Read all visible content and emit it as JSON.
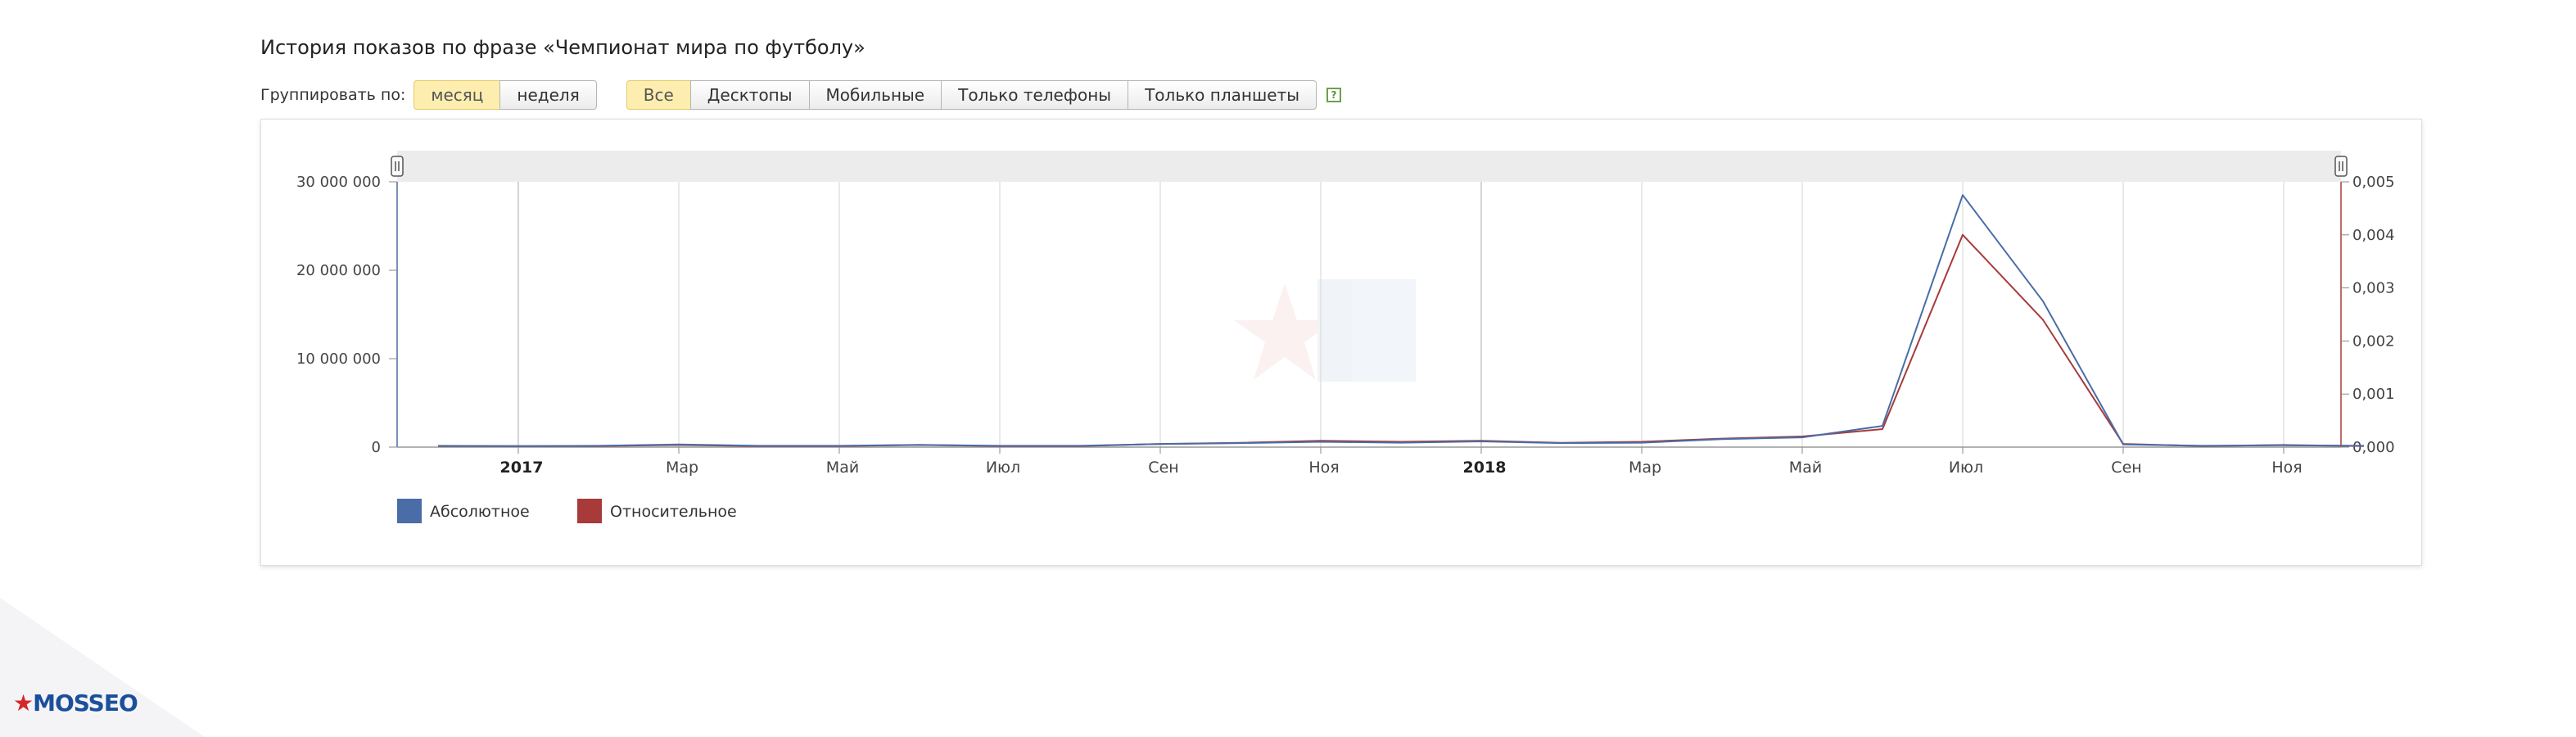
{
  "title": "История показов по фразе «Чемпионат мира по футболу»",
  "group_label": "Группировать по:",
  "group_buttons": [
    {
      "label": "месяц",
      "active": true
    },
    {
      "label": "неделя",
      "active": false
    }
  ],
  "device_buttons": [
    {
      "label": "Все",
      "active": true
    },
    {
      "label": "Десктопы",
      "active": false
    },
    {
      "label": "Мобильные",
      "active": false
    },
    {
      "label": "Только телефоны",
      "active": false
    },
    {
      "label": "Только планшеты",
      "active": false
    }
  ],
  "help_icon": "?",
  "watermark_logo": {
    "star": "★",
    "text": "MOSSEO",
    "text_color": "#1b4f9c",
    "star_color": "#d6262b"
  },
  "chart_data": {
    "type": "line",
    "title": "",
    "x_labels": [
      "2017",
      "Мар",
      "Май",
      "Июл",
      "Сен",
      "Ноя",
      "2018",
      "Мар",
      "Май",
      "Июл",
      "Сен",
      "Ноя"
    ],
    "year_labels": [
      "2017",
      "2018"
    ],
    "x": [
      "2016-12",
      "2017-01",
      "2017-02",
      "2017-03",
      "2017-04",
      "2017-05",
      "2017-06",
      "2017-07",
      "2017-08",
      "2017-09",
      "2017-10",
      "2017-11",
      "2017-12",
      "2018-01",
      "2018-02",
      "2018-03",
      "2018-04",
      "2018-05",
      "2018-06",
      "2018-07",
      "2018-08",
      "2018-09",
      "2018-10",
      "2018-11",
      "2018-12"
    ],
    "y_left": {
      "ylim": [
        0,
        30000000
      ],
      "ticks": [
        0,
        10000000,
        20000000,
        30000000
      ],
      "tick_labels": [
        "0",
        "10 000 000",
        "20 000 000",
        "30 000 000"
      ]
    },
    "y_right": {
      "ylim": [
        0,
        0.005
      ],
      "ticks": [
        0,
        0.001,
        0.002,
        0.003,
        0.004,
        0.005
      ],
      "tick_labels": [
        "0,000",
        "0,001",
        "0,002",
        "0,003",
        "0,004",
        "0,005"
      ]
    },
    "series": [
      {
        "name": "Абсолютное",
        "axis": "left",
        "color": "#4a6da7",
        "values": [
          150000,
          120000,
          150000,
          300000,
          150000,
          150000,
          250000,
          150000,
          150000,
          350000,
          450000,
          600000,
          500000,
          650000,
          450000,
          500000,
          900000,
          1100000,
          2400000,
          28500000,
          16500000,
          300000,
          150000,
          200000,
          150000
        ]
      },
      {
        "name": "Относительное",
        "axis": "right",
        "color": "#a83a3a",
        "values": [
          2e-05,
          2e-05,
          2e-05,
          4e-05,
          2e-05,
          2e-05,
          4e-05,
          2e-05,
          2e-05,
          6e-05,
          8e-05,
          0.00012,
          0.0001,
          0.00012,
          8e-05,
          0.0001,
          0.00016,
          0.0002,
          0.00034,
          0.004,
          0.0024,
          6e-05,
          2e-05,
          4e-05,
          2e-05
        ]
      }
    ],
    "legend": {
      "position": "bottom-left"
    },
    "grid": {
      "x": true,
      "y": false
    }
  }
}
